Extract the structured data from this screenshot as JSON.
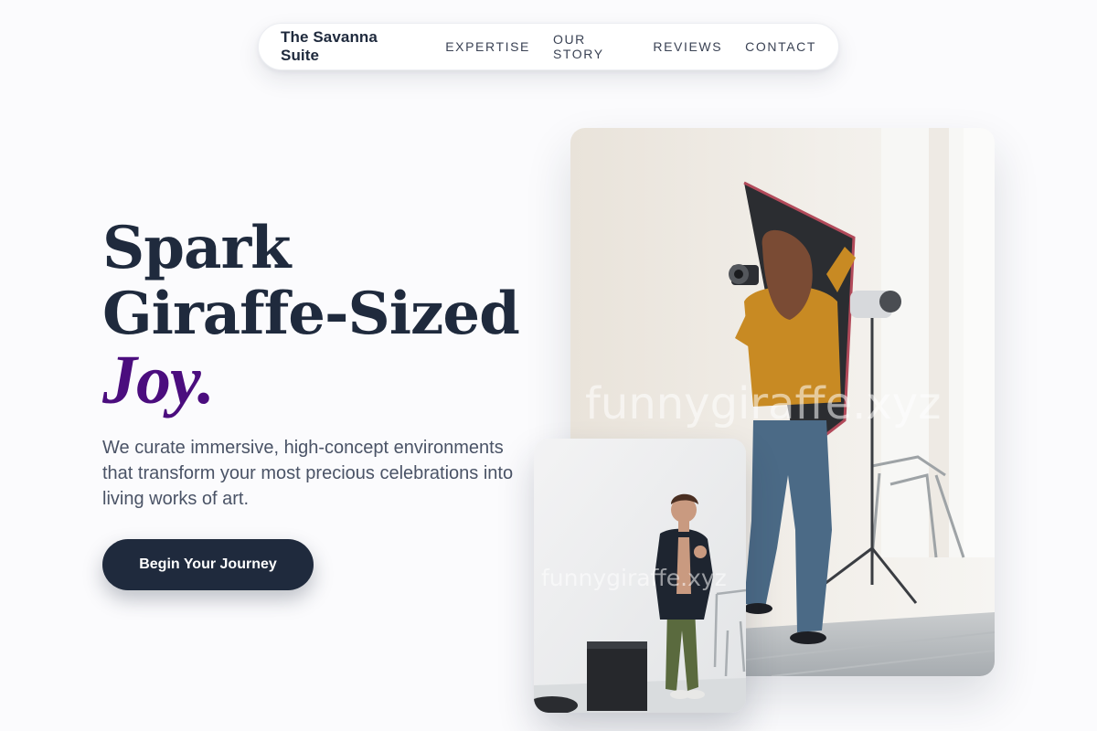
{
  "nav": {
    "brand": "The Savanna Suite",
    "links": [
      "EXPERTISE",
      "OUR STORY",
      "REVIEWS",
      "CONTACT"
    ]
  },
  "hero": {
    "title_line1": "Spark",
    "title_line2": "Giraffe-Sized",
    "title_accent": "Joy.",
    "description": "We curate immersive, high-concept environments that transform your most precious celebrations into living works of art.",
    "cta_label": "Begin Your Journey"
  },
  "images": {
    "main_watermark": "funnygiraffe.xyz",
    "small_watermark": "funnygiraffe.xyz"
  },
  "colors": {
    "navy": "#1f2a3d",
    "accent_purple": "#4b0d7e",
    "background": "#fbfbfd"
  }
}
